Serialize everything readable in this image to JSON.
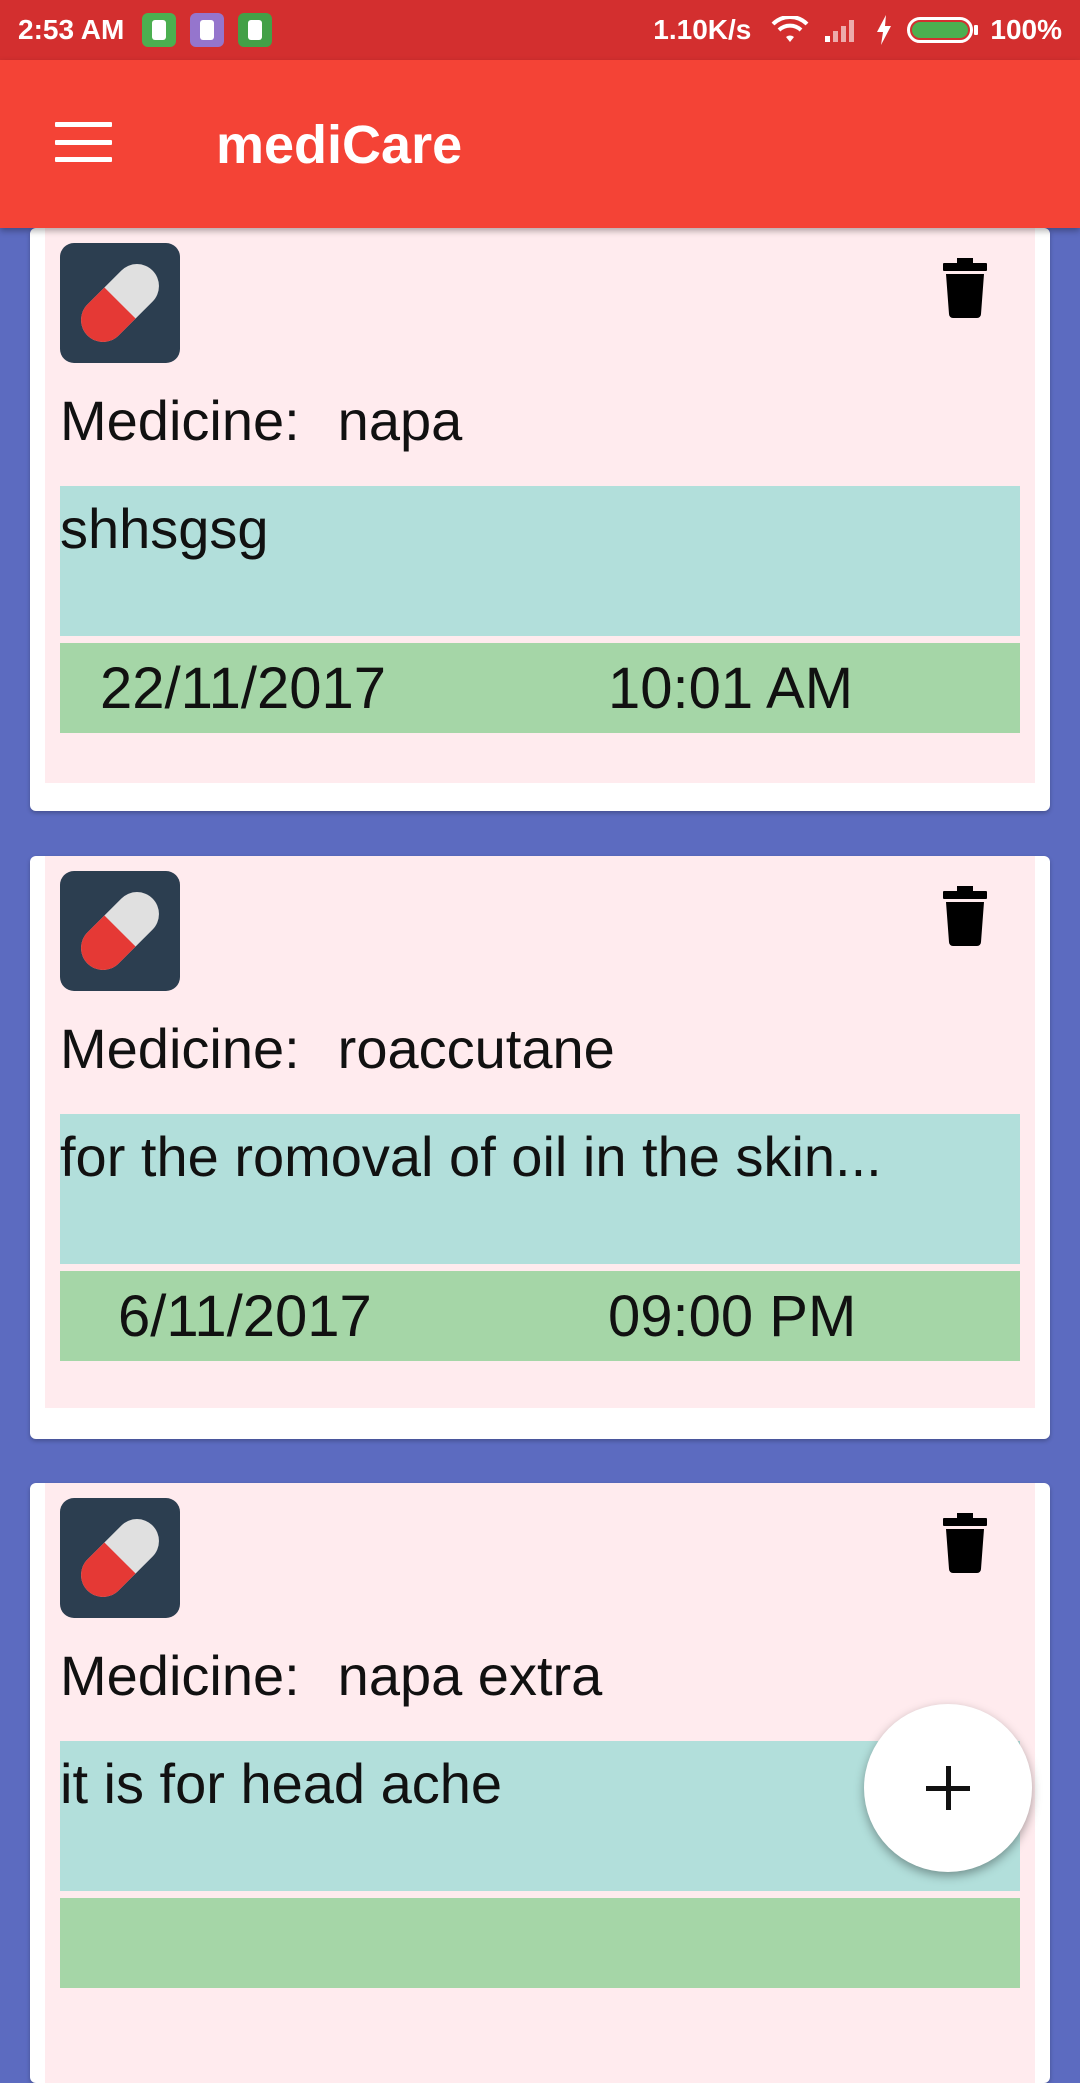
{
  "status_bar": {
    "time": "2:53 AM",
    "net_speed": "1.10K/s",
    "battery_percent": "100%"
  },
  "app_bar": {
    "title": "mediCare"
  },
  "medicines": [
    {
      "label": "Medicine:",
      "name": "napa",
      "description": "shhsgsg",
      "date": "22/11/2017",
      "time": "10:01 AM"
    },
    {
      "label": "Medicine:",
      "name": "roaccutane",
      "description": "for the romoval of oil in the skin...",
      "date": "6/11/2017",
      "time": "09:00 PM"
    },
    {
      "label": "Medicine:",
      "name": "napa extra",
      "description": "it is for head ache",
      "date": "",
      "time": ""
    }
  ],
  "colors": {
    "status_bar": "#D32F2F",
    "app_bar": "#F44336",
    "background": "#5C6BC0",
    "card_inner": "#FFEBEE",
    "description_box": "#B2DFDB",
    "datetime_box": "#A5D6A7"
  },
  "icons": {
    "menu": "hamburger-menu-icon",
    "medicine": "pill-capsule-icon",
    "delete": "trash-icon",
    "add": "plus-icon"
  }
}
